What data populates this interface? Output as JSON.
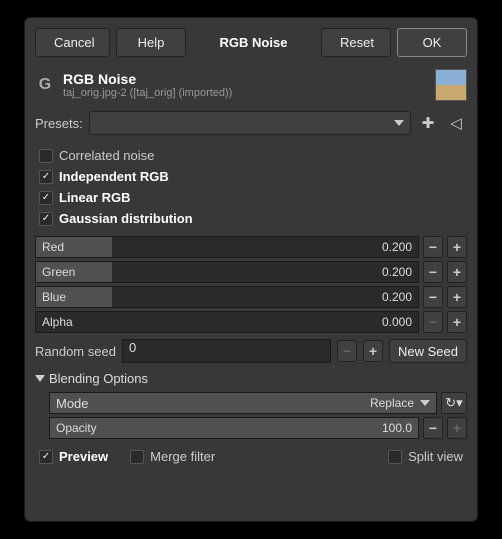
{
  "buttons": {
    "cancel": "Cancel",
    "help": "Help",
    "title": "RGB Noise",
    "reset": "Reset",
    "ok": "OK"
  },
  "header": {
    "title": "RGB Noise",
    "subtitle": "taj_orig.jpg-2 ([taj_orig] (imported))"
  },
  "presets": {
    "label": "Presets:"
  },
  "checks": {
    "correlated": "Correlated noise",
    "independent": "Independent RGB",
    "linear": "Linear RGB",
    "gaussian": "Gaussian distribution"
  },
  "sliders": {
    "red": {
      "label": "Red",
      "value": "0.200",
      "fill": 20
    },
    "green": {
      "label": "Green",
      "value": "0.200",
      "fill": 20
    },
    "blue": {
      "label": "Blue",
      "value": "0.200",
      "fill": 20
    },
    "alpha": {
      "label": "Alpha",
      "value": "0.000",
      "fill": 0
    }
  },
  "seed": {
    "label": "Random seed",
    "value": "0",
    "new": "New Seed"
  },
  "blending": {
    "title": "Blending Options",
    "mode_label": "Mode",
    "mode_value": "Replace",
    "opacity_label": "Opacity",
    "opacity_value": "100.0"
  },
  "footer": {
    "preview": "Preview",
    "merge": "Merge filter",
    "split": "Split view"
  }
}
